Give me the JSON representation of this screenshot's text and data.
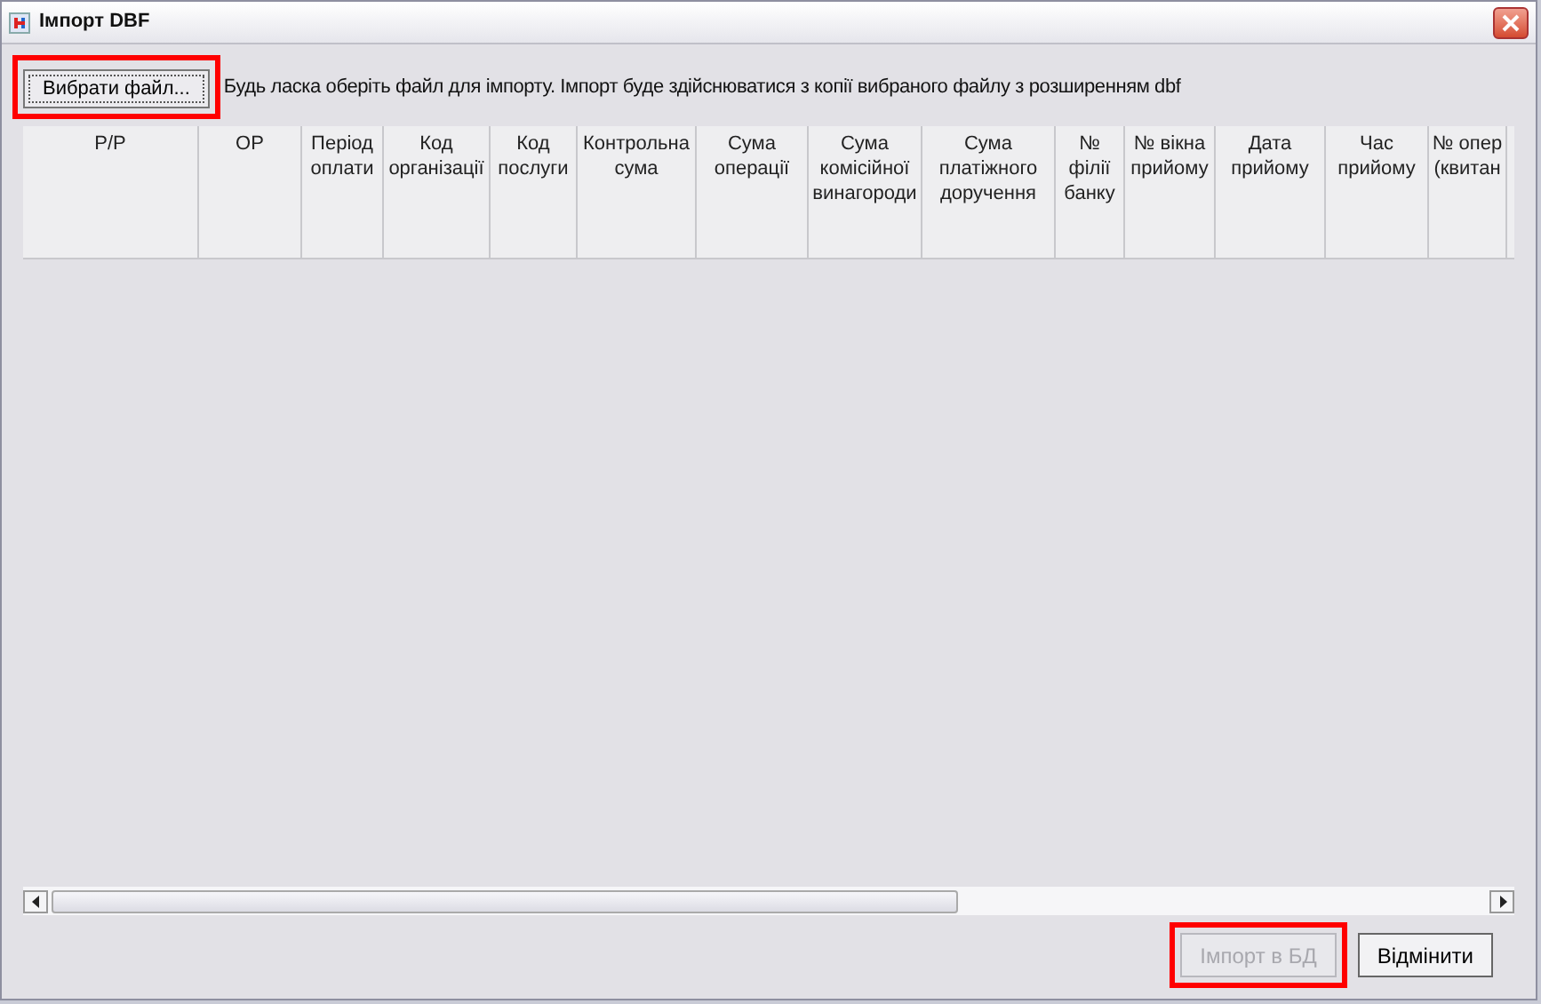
{
  "window": {
    "title": "Імпорт DBF"
  },
  "choose_button": {
    "label": "Вибрати файл...",
    "highlighted": true
  },
  "hint": "Будь ласка оберіть файл для імпорту. Імпорт буде здійснюватися з копії вибраного файлу з розширенням dbf",
  "table": {
    "columns": [
      "Р/Р",
      "ОР",
      "Період\nоплати",
      "Код\nорганізації",
      "Код\nпослуги",
      "Контрольна\nсума",
      "Сума\nоперації",
      "Сума\nкомісійної\nвинагороди",
      "Сума\nплатіжного\nдоручення",
      "№\nфілії\nбанку",
      "№ вікна\nприйому",
      "Дата\nприйому",
      "Час\nприйому",
      "№ опер\n(квитан"
    ]
  },
  "buttons": [
    {
      "label": "Імпорт в БД",
      "disabled": true,
      "highlighted": true
    },
    {
      "label": "Відмінити",
      "disabled": false,
      "highlighted": false
    }
  ]
}
